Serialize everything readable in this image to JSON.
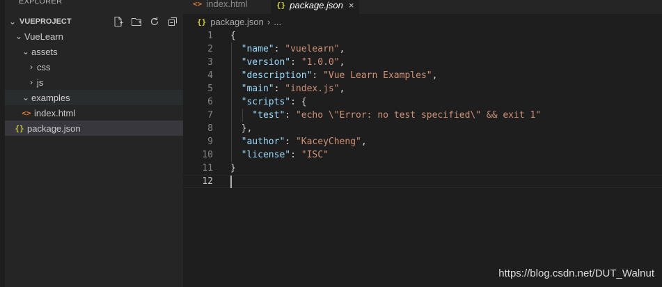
{
  "sidebar": {
    "title": "EXPLORER",
    "section": "VUEPROJECT",
    "actions": [
      {
        "name": "new-file-icon"
      },
      {
        "name": "new-folder-icon"
      },
      {
        "name": "refresh-icon"
      },
      {
        "name": "collapse-all-icon"
      }
    ],
    "tree": [
      {
        "label": "VueLearn",
        "twisty": "⌄",
        "icon": ""
      },
      {
        "label": "assets",
        "twisty": "⌄",
        "icon": ""
      },
      {
        "label": "css",
        "twisty": "›",
        "icon": ""
      },
      {
        "label": "js",
        "twisty": "›",
        "icon": ""
      },
      {
        "label": "examples",
        "twisty": "⌄",
        "icon": ""
      },
      {
        "label": "index.html",
        "twisty": "",
        "icon": "<>"
      },
      {
        "label": "package.json",
        "twisty": "",
        "icon": "{}"
      }
    ]
  },
  "tabs": [
    {
      "label": "index.html",
      "icon": "<>"
    },
    {
      "label": "package.json",
      "icon": "{}",
      "close": "×"
    }
  ],
  "breadcrumb": {
    "icon": "{}",
    "file": "package.json",
    "sep": "›",
    "more": "..."
  },
  "editor": {
    "lines": [
      {
        "n": "1",
        "tokens": [
          [
            "p",
            "{"
          ]
        ]
      },
      {
        "n": "2",
        "tokens": [
          [
            "p",
            "  "
          ],
          [
            "k",
            "\"name\""
          ],
          [
            "p",
            ": "
          ],
          [
            "s",
            "\"vuelearn\""
          ],
          [
            "p",
            ","
          ]
        ]
      },
      {
        "n": "3",
        "tokens": [
          [
            "p",
            "  "
          ],
          [
            "k",
            "\"version\""
          ],
          [
            "p",
            ": "
          ],
          [
            "s",
            "\"1.0.0\""
          ],
          [
            "p",
            ","
          ]
        ]
      },
      {
        "n": "4",
        "tokens": [
          [
            "p",
            "  "
          ],
          [
            "k",
            "\"description\""
          ],
          [
            "p",
            ": "
          ],
          [
            "s",
            "\"Vue Learn Examples\""
          ],
          [
            "p",
            ","
          ]
        ]
      },
      {
        "n": "5",
        "tokens": [
          [
            "p",
            "  "
          ],
          [
            "k",
            "\"main\""
          ],
          [
            "p",
            ": "
          ],
          [
            "s",
            "\"index.js\""
          ],
          [
            "p",
            ","
          ]
        ]
      },
      {
        "n": "6",
        "tokens": [
          [
            "p",
            "  "
          ],
          [
            "k",
            "\"scripts\""
          ],
          [
            "p",
            ": {"
          ]
        ]
      },
      {
        "n": "7",
        "tokens": [
          [
            "p",
            "    "
          ],
          [
            "k",
            "\"test\""
          ],
          [
            "p",
            ": "
          ],
          [
            "s",
            "\"echo \\\"Error: no test specified\\\" && exit 1\""
          ]
        ]
      },
      {
        "n": "8",
        "tokens": [
          [
            "p",
            "  },"
          ]
        ]
      },
      {
        "n": "9",
        "tokens": [
          [
            "p",
            "  "
          ],
          [
            "k",
            "\"author\""
          ],
          [
            "p",
            ": "
          ],
          [
            "s",
            "\"KaceyCheng\""
          ],
          [
            "p",
            ","
          ]
        ]
      },
      {
        "n": "10",
        "tokens": [
          [
            "p",
            "  "
          ],
          [
            "k",
            "\"license\""
          ],
          [
            "p",
            ": "
          ],
          [
            "s",
            "\"ISC\""
          ]
        ]
      },
      {
        "n": "11",
        "tokens": [
          [
            "p",
            "}"
          ]
        ]
      },
      {
        "n": "12",
        "tokens": []
      }
    ]
  },
  "watermark": "https://blog.csdn.net/DUT_Walnut",
  "colors": {
    "key": "#9cdcfe",
    "string": "#ce9178",
    "html_icon": "#e37933",
    "json_icon": "#cbcb41"
  }
}
